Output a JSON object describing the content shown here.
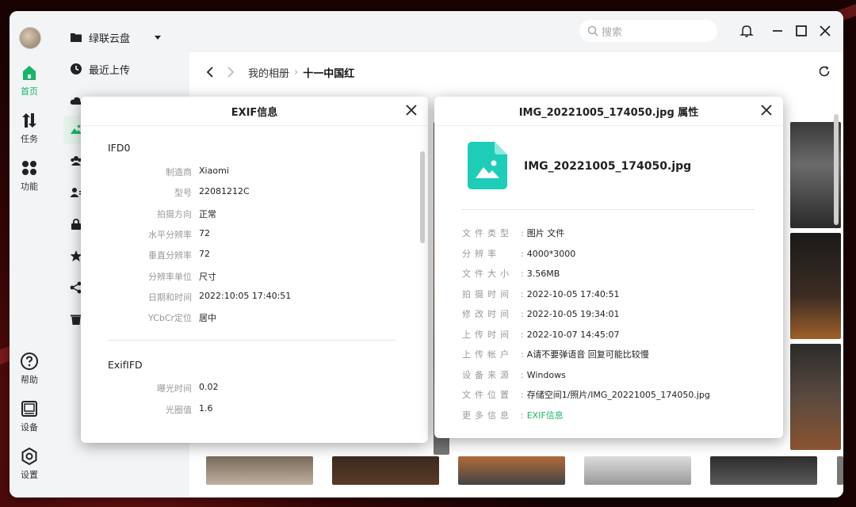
{
  "rail": {
    "home": "首页",
    "tasks": "任务",
    "features": "功能",
    "help": "帮助",
    "device": "设备",
    "settings": "设置"
  },
  "nav": {
    "cloud": "绿联云盘",
    "recent": "最近上传"
  },
  "search": {
    "placeholder": "搜索"
  },
  "breadcrumb": {
    "parent": "我的相册",
    "current": "十一中国红"
  },
  "exif_dialog": {
    "title": "EXIF信息",
    "ifd0": {
      "title": "IFD0",
      "rows": [
        {
          "k": "制造商",
          "v": "Xiaomi"
        },
        {
          "k": "型号",
          "v": "22081212C"
        },
        {
          "k": "拍摄方向",
          "v": "正常"
        },
        {
          "k": "水平分辨率",
          "v": "72"
        },
        {
          "k": "垂直分辨率",
          "v": "72"
        },
        {
          "k": "分辨率单位",
          "v": "尺寸"
        },
        {
          "k": "日期和时间",
          "v": "2022:10:05 17:40:51"
        },
        {
          "k": "YCbCr定位",
          "v": "居中"
        }
      ]
    },
    "exififd": {
      "title": "ExifIFD",
      "rows": [
        {
          "k": "曝光时间",
          "v": "0.02"
        },
        {
          "k": "光圈值",
          "v": "1.6"
        }
      ]
    }
  },
  "props_dialog": {
    "title": "IMG_20221005_174050.jpg 属性",
    "filename": "IMG_20221005_174050.jpg",
    "rows": [
      {
        "k": "文件类型",
        "v": "图片 文件"
      },
      {
        "k": "分辨率",
        "v": "4000*3000"
      },
      {
        "k": "文件大小",
        "v": "3.56MB"
      },
      {
        "k": "拍摄时间",
        "v": "2022-10-05 17:40:51"
      },
      {
        "k": "修改时间",
        "v": "2022-10-05 19:34:01"
      },
      {
        "k": "上传时间",
        "v": "2022-10-07 14:45:07"
      },
      {
        "k": "上传帐户",
        "v": "A请不要弹语音 回复可能比较慢"
      },
      {
        "k": "设备来源",
        "v": "Windows"
      },
      {
        "k": "文件位置",
        "v": "存储空间1/照片/IMG_20221005_174050.jpg"
      },
      {
        "k": "更多信息",
        "v": "EXIF信息"
      }
    ]
  },
  "colors": {
    "accent": "#18b566",
    "file_icon": "#1dcdb8"
  }
}
